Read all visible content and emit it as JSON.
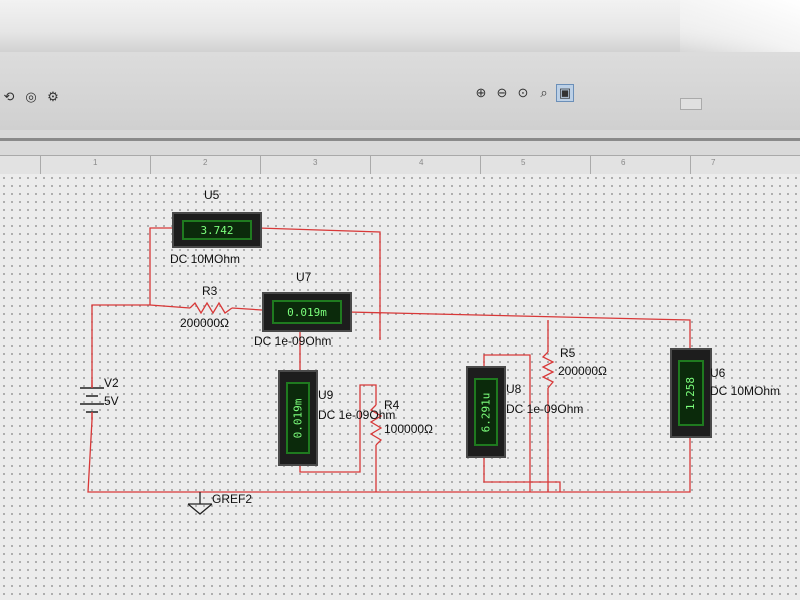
{
  "toolbar": {
    "left_icons": [
      "arrow-icon",
      "tool-icon",
      "gear-icon"
    ],
    "zoom_icons": [
      "zoom-in-icon",
      "zoom-out-icon",
      "zoom-area-icon",
      "zoom-fit-icon",
      "full-screen-icon"
    ]
  },
  "ruler": {
    "labels": [
      "1",
      "2",
      "3",
      "4",
      "5",
      "6",
      "7"
    ]
  },
  "components": {
    "U5": {
      "ref": "U5",
      "reading": "3.742",
      "mode": "DC 10MOhm"
    },
    "U7": {
      "ref": "U7",
      "reading": "0.019m",
      "mode": "DC 1e-09Ohm"
    },
    "U9": {
      "ref": "U9",
      "reading": "0.019m",
      "mode": "DC 1e-09Ohm"
    },
    "U8": {
      "ref": "U8",
      "reading": "6.291u",
      "mode": "DC 1e-09Ohm"
    },
    "U6": {
      "ref": "U6",
      "reading": "1.258",
      "mode": "DC 10MOhm"
    },
    "R3": {
      "ref": "R3",
      "value": "200000Ω"
    },
    "R4": {
      "ref": "R4",
      "value": "100000Ω"
    },
    "R5": {
      "ref": "R5",
      "value": "200000Ω"
    },
    "V2": {
      "ref": "V2",
      "value": "5V"
    },
    "GND": {
      "ref": "GREF2"
    }
  },
  "colors": {
    "wire": "#d83838",
    "meter_text": "#7cff7c",
    "canvas": "#ececec"
  }
}
